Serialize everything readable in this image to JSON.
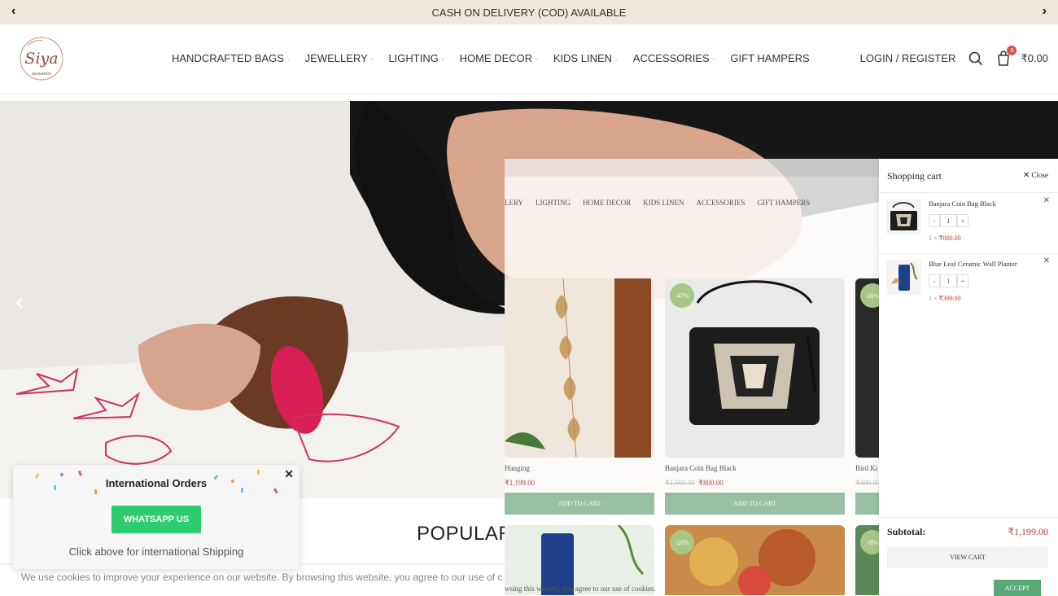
{
  "topbar": {
    "announcement": "CASH ON DELIVERY (COD) AVAILABLE"
  },
  "nav": {
    "items": [
      {
        "label": "HANDCRAFTED BAGS",
        "has_dropdown": true
      },
      {
        "label": "JEWELLERY",
        "has_dropdown": true
      },
      {
        "label": "LIGHTING",
        "has_dropdown": true
      },
      {
        "label": "HOME DECOR",
        "has_dropdown": true
      },
      {
        "label": "KIDS LINEN",
        "has_dropdown": true
      },
      {
        "label": "ACCESSORIES",
        "has_dropdown": true
      },
      {
        "label": "GIFT HAMPERS",
        "has_dropdown": false
      }
    ]
  },
  "header": {
    "login_label": "LOGIN / REGISTER",
    "cart_count": "0",
    "cart_total": "₹0.00"
  },
  "hero": {
    "section_title": "POPULAR"
  },
  "popup": {
    "title": "International Orders",
    "button_label": "WHATSAPP US",
    "text": "Click above for international Shipping"
  },
  "cookie": {
    "text": "We use cookies to improve your experience on our website. By browsing this website, you agree to our use of c",
    "overlay_text": "wsing this website, you agree to our use of cookies.",
    "accept_label": "ACCEPT"
  },
  "overlay": {
    "nav": [
      "LERY",
      "LIGHTING",
      "HOME DECOR",
      "KIDS LINEN",
      "ACCESSORIES",
      "GIFT HAMPERS"
    ],
    "products": [
      {
        "name": "Hanging",
        "price": "₹1,199.00",
        "old_price": "",
        "badge": "",
        "cta": "ADD TO CART"
      },
      {
        "name": "Banjara Coin Bag Black",
        "price": "₹800.00",
        "old_price": "₹1,500.00",
        "badge": "-47%",
        "cta": "ADD TO CART"
      },
      {
        "name": "Bird Ki",
        "price": "",
        "old_price": "₹499.00",
        "badge": "-20%",
        "cta": ""
      }
    ],
    "row2_badges": [
      "-20%",
      "-8%"
    ]
  },
  "cart": {
    "title": "Shopping cart",
    "close_label": "Close",
    "items": [
      {
        "name": "Banjara Coin Bag Black",
        "qty": "1",
        "qty_prefix": "1 ×",
        "price": "₹800.00"
      },
      {
        "name": "Blue Leaf Ceramic Wall Planter",
        "qty": "1",
        "qty_prefix": "1 ×",
        "price": "₹399.00"
      }
    ],
    "subtotal_label": "Subtotal:",
    "subtotal_value": "₹1,199.00",
    "view_cart_label": "VIEW CART"
  },
  "colors": {
    "accent_green": "#2ecc71",
    "price_red": "#b0443a",
    "topbar_bg": "#efe8dd",
    "badge_green": "#a8c686",
    "cart_badge": "#d9534f"
  }
}
